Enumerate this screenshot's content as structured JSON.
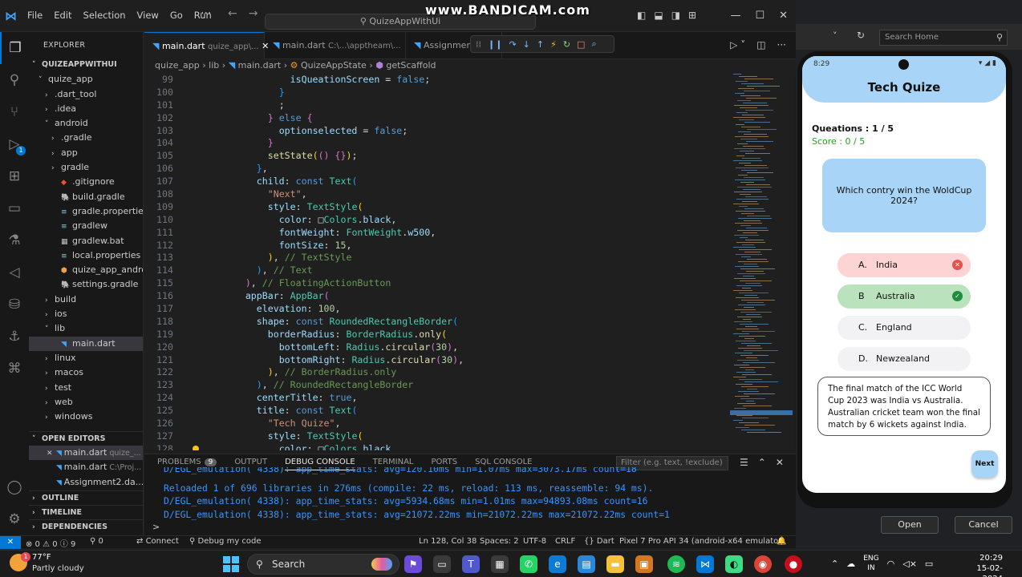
{
  "titlebar": {
    "menu": [
      "File",
      "Edit",
      "Selection",
      "View",
      "Go",
      "Run"
    ],
    "more": "···",
    "search": "QuizeAppWithUi",
    "watermark": "www.BANDICAM.com"
  },
  "sidebar": {
    "header": "EXPLORER",
    "project": "QUIZEAPPWITHUI",
    "tree": [
      {
        "label": "quize_app",
        "depth": 1,
        "chev": "˅",
        "icon": ""
      },
      {
        "label": ".dart_tool",
        "depth": 2,
        "chev": "›",
        "icon": ""
      },
      {
        "label": ".idea",
        "depth": 2,
        "chev": "›",
        "icon": ""
      },
      {
        "label": "android",
        "depth": 2,
        "chev": "˅",
        "icon": ""
      },
      {
        "label": ".gradle",
        "depth": 3,
        "chev": "›",
        "icon": ""
      },
      {
        "label": "app",
        "depth": 3,
        "chev": "›",
        "icon": ""
      },
      {
        "label": "gradle",
        "depth": 3,
        "chev": "›",
        "icon": ""
      },
      {
        "label": ".gitignore",
        "depth": 3,
        "chev": "",
        "icon": "◆"
      },
      {
        "label": "build.gradle",
        "depth": 3,
        "chev": "",
        "icon": "🐘"
      },
      {
        "label": "gradle.properties",
        "depth": 3,
        "chev": "",
        "icon": "≡"
      },
      {
        "label": "gradlew",
        "depth": 3,
        "chev": "",
        "icon": "≡"
      },
      {
        "label": "gradlew.bat",
        "depth": 3,
        "chev": "",
        "icon": "▦"
      },
      {
        "label": "local.properties",
        "depth": 3,
        "chev": "",
        "icon": "≡"
      },
      {
        "label": "quize_app_android...",
        "depth": 3,
        "chev": "",
        "icon": "⬢"
      },
      {
        "label": "settings.gradle",
        "depth": 3,
        "chev": "",
        "icon": "🐘"
      },
      {
        "label": "build",
        "depth": 2,
        "chev": "›",
        "icon": ""
      },
      {
        "label": "ios",
        "depth": 2,
        "chev": "›",
        "icon": ""
      },
      {
        "label": "lib",
        "depth": 2,
        "chev": "˅",
        "icon": ""
      },
      {
        "label": "main.dart",
        "depth": 3,
        "chev": "",
        "icon": "◥",
        "selected": true
      },
      {
        "label": "linux",
        "depth": 2,
        "chev": "›",
        "icon": ""
      },
      {
        "label": "macos",
        "depth": 2,
        "chev": "›",
        "icon": ""
      },
      {
        "label": "test",
        "depth": 2,
        "chev": "›",
        "icon": ""
      },
      {
        "label": "web",
        "depth": 2,
        "chev": "›",
        "icon": ""
      },
      {
        "label": "windows",
        "depth": 2,
        "chev": "›",
        "icon": ""
      }
    ],
    "open_editors_header": "OPEN EDITORS",
    "open_editors": [
      {
        "name": "main.dart",
        "path": "quize_...",
        "close": "✕"
      },
      {
        "name": "main.dart",
        "path": "C:\\Proj...",
        "close": ""
      },
      {
        "name": "Assignment2.da...",
        "path": "",
        "close": ""
      }
    ],
    "outline": "OUTLINE",
    "timeline": "TIMELINE",
    "dependencies": "DEPENDENCIES"
  },
  "tabs": [
    {
      "name": "main.dart",
      "path": "quize_app\\..."
    },
    {
      "name": "main.dart",
      "path": "C:\\...\\apptheam\\..."
    },
    {
      "name": "Assignment2.dart",
      "path": ""
    }
  ],
  "breadcrumb": [
    "quize_app",
    "lib",
    "main.dart",
    "QuizeAppState",
    "getScaffold"
  ],
  "code": [
    {
      "n": "99",
      "indent": 18,
      "parts": [
        [
          "prop",
          "isQueationScreen"
        ],
        [
          "plain",
          " = "
        ],
        [
          "kw",
          "false"
        ],
        [
          "plain",
          ";"
        ]
      ]
    },
    {
      "n": "100",
      "indent": 16,
      "parts": [
        [
          "br3",
          "}"
        ]
      ]
    },
    {
      "n": "101",
      "indent": 16,
      "parts": [
        [
          "plain",
          ";"
        ]
      ]
    },
    {
      "n": "102",
      "indent": 14,
      "parts": [
        [
          "br2",
          "}"
        ],
        [
          "plain",
          " "
        ],
        [
          "kw",
          "else"
        ],
        [
          "plain",
          " "
        ],
        [
          "br2",
          "{"
        ]
      ]
    },
    {
      "n": "103",
      "indent": 16,
      "parts": [
        [
          "prop",
          "optionselected"
        ],
        [
          "plain",
          " = "
        ],
        [
          "kw",
          "false"
        ],
        [
          "plain",
          ";"
        ]
      ]
    },
    {
      "n": "104",
      "indent": 14,
      "parts": [
        [
          "br2",
          "}"
        ]
      ]
    },
    {
      "n": "105",
      "indent": 14,
      "parts": [
        [
          "fn",
          "setState"
        ],
        [
          "br1",
          "("
        ],
        [
          "br2",
          "()"
        ],
        [
          "plain",
          " "
        ],
        [
          "br2",
          "{}"
        ],
        [
          "br1",
          ")"
        ],
        [
          "plain",
          ";"
        ]
      ]
    },
    {
      "n": "106",
      "indent": 12,
      "parts": [
        [
          "br3",
          "}"
        ],
        [
          "plain",
          ","
        ]
      ]
    },
    {
      "n": "107",
      "indent": 12,
      "parts": [
        [
          "prop",
          "child"
        ],
        [
          "plain",
          ": "
        ],
        [
          "kw",
          "const"
        ],
        [
          "plain",
          " "
        ],
        [
          "cls",
          "Text"
        ],
        [
          "br3",
          "("
        ]
      ]
    },
    {
      "n": "108",
      "indent": 14,
      "parts": [
        [
          "str",
          "\"Next\""
        ],
        [
          "plain",
          ","
        ]
      ]
    },
    {
      "n": "109",
      "indent": 14,
      "parts": [
        [
          "prop",
          "style"
        ],
        [
          "plain",
          ": "
        ],
        [
          "cls",
          "TextStyle"
        ],
        [
          "br1",
          "("
        ]
      ]
    },
    {
      "n": "110",
      "indent": 16,
      "parts": [
        [
          "prop",
          "color"
        ],
        [
          "plain",
          ": □"
        ],
        [
          "cls",
          "Colors"
        ],
        [
          "plain",
          "."
        ],
        [
          "prop",
          "black"
        ],
        [
          "plain",
          ","
        ]
      ]
    },
    {
      "n": "111",
      "indent": 16,
      "parts": [
        [
          "prop",
          "fontWeight"
        ],
        [
          "plain",
          ": "
        ],
        [
          "cls",
          "FontWeight"
        ],
        [
          "plain",
          "."
        ],
        [
          "prop",
          "w500"
        ],
        [
          "plain",
          ","
        ]
      ]
    },
    {
      "n": "112",
      "indent": 16,
      "parts": [
        [
          "prop",
          "fontSize"
        ],
        [
          "plain",
          ": "
        ],
        [
          "num",
          "15"
        ],
        [
          "plain",
          ","
        ]
      ]
    },
    {
      "n": "113",
      "indent": 14,
      "parts": [
        [
          "br1",
          ")"
        ],
        [
          "plain",
          ", "
        ],
        [
          "cmt",
          "// TextStyle"
        ]
      ]
    },
    {
      "n": "114",
      "indent": 12,
      "parts": [
        [
          "br3",
          ")"
        ],
        [
          "plain",
          ", "
        ],
        [
          "cmt",
          "// Text"
        ]
      ]
    },
    {
      "n": "115",
      "indent": 10,
      "parts": [
        [
          "br2",
          ")"
        ],
        [
          "plain",
          ", "
        ],
        [
          "cmt",
          "// FloatingActionButton"
        ]
      ]
    },
    {
      "n": "116",
      "indent": 10,
      "parts": [
        [
          "prop",
          "appBar"
        ],
        [
          "plain",
          ": "
        ],
        [
          "cls",
          "AppBar"
        ],
        [
          "br2",
          "("
        ]
      ]
    },
    {
      "n": "117",
      "indent": 12,
      "parts": [
        [
          "prop",
          "elevation"
        ],
        [
          "plain",
          ": "
        ],
        [
          "num",
          "100"
        ],
        [
          "plain",
          ","
        ]
      ]
    },
    {
      "n": "118",
      "indent": 12,
      "parts": [
        [
          "prop",
          "shape"
        ],
        [
          "plain",
          ": "
        ],
        [
          "kw",
          "const"
        ],
        [
          "plain",
          " "
        ],
        [
          "cls",
          "RoundedRectangleBorder"
        ],
        [
          "br3",
          "("
        ]
      ]
    },
    {
      "n": "119",
      "indent": 14,
      "parts": [
        [
          "prop",
          "borderRadius"
        ],
        [
          "plain",
          ": "
        ],
        [
          "cls",
          "BorderRadius"
        ],
        [
          "plain",
          "."
        ],
        [
          "fn",
          "only"
        ],
        [
          "br1",
          "("
        ]
      ]
    },
    {
      "n": "120",
      "indent": 16,
      "parts": [
        [
          "prop",
          "bottomLeft"
        ],
        [
          "plain",
          ": "
        ],
        [
          "cls",
          "Radius"
        ],
        [
          "plain",
          "."
        ],
        [
          "fn",
          "circular"
        ],
        [
          "br2",
          "("
        ],
        [
          "num",
          "30"
        ],
        [
          "br2",
          ")"
        ],
        [
          "plain",
          ","
        ]
      ]
    },
    {
      "n": "121",
      "indent": 16,
      "parts": [
        [
          "prop",
          "bottomRight"
        ],
        [
          "plain",
          ": "
        ],
        [
          "cls",
          "Radius"
        ],
        [
          "plain",
          "."
        ],
        [
          "fn",
          "circular"
        ],
        [
          "br2",
          "("
        ],
        [
          "num",
          "30"
        ],
        [
          "br2",
          ")"
        ],
        [
          "plain",
          ","
        ]
      ]
    },
    {
      "n": "122",
      "indent": 14,
      "parts": [
        [
          "br1",
          ")"
        ],
        [
          "plain",
          ", "
        ],
        [
          "cmt",
          "// BorderRadius.only"
        ]
      ]
    },
    {
      "n": "123",
      "indent": 12,
      "parts": [
        [
          "br3",
          ")"
        ],
        [
          "plain",
          ", "
        ],
        [
          "cmt",
          "// RoundedRectangleBorder"
        ]
      ]
    },
    {
      "n": "124",
      "indent": 12,
      "parts": [
        [
          "prop",
          "centerTitle"
        ],
        [
          "plain",
          ": "
        ],
        [
          "kw",
          "true"
        ],
        [
          "plain",
          ","
        ]
      ]
    },
    {
      "n": "125",
      "indent": 12,
      "parts": [
        [
          "prop",
          "title"
        ],
        [
          "plain",
          ": "
        ],
        [
          "kw",
          "const"
        ],
        [
          "plain",
          " "
        ],
        [
          "cls",
          "Text"
        ],
        [
          "br3",
          "("
        ]
      ]
    },
    {
      "n": "126",
      "indent": 14,
      "parts": [
        [
          "str",
          "\"Tech Quize\""
        ],
        [
          "plain",
          ","
        ]
      ]
    },
    {
      "n": "127",
      "indent": 14,
      "parts": [
        [
          "prop",
          "style"
        ],
        [
          "plain",
          ": "
        ],
        [
          "cls",
          "TextStyle"
        ],
        [
          "br1",
          "("
        ]
      ]
    },
    {
      "n": "128",
      "indent": 16,
      "parts": [
        [
          "prop",
          "color"
        ],
        [
          "plain",
          ": □"
        ],
        [
          "cls",
          "Colors"
        ],
        [
          "plain",
          "."
        ],
        [
          "prop",
          "black"
        ]
      ]
    }
  ],
  "panel": {
    "tabs": [
      "PROBLEMS",
      "OUTPUT",
      "DEBUG CONSOLE",
      "TERMINAL",
      "PORTS",
      "SQL CONSOLE"
    ],
    "problems_count": "9",
    "filter_placeholder": "Filter (e.g. text, !exclude)",
    "console": [
      "D/EGL_emulation( 4338): app_time_stats: avg=120.10ms min=1.07ms max=3073.17ms count=18",
      "Reloaded 1 of 696 libraries in 276ms (compile: 22 ms, reload: 113 ms, reassemble: 94 ms).",
      "D/EGL_emulation( 4338): app_time_stats: avg=5934.68ms min=1.01ms max=94893.08ms count=16",
      "D/EGL_emulation( 4338): app_time_stats: avg=21072.22ms min=21072.22ms max=21072.22ms count=1"
    ],
    "prompt": ">"
  },
  "status": {
    "errors": "⊗ 0 ⚠ 0 ⓘ 9",
    "ports": "⚲ 0",
    "connect": "Connect",
    "debug": "Debug my code",
    "position": "Ln 128, Col 38",
    "spaces": "Spaces: 2",
    "encoding": "UTF-8",
    "eol": "CRLF",
    "language": "{} Dart",
    "device": "Pixel 7 Pro API 34 (android-x64 emulator)"
  },
  "browser": {
    "search_placeholder": "Search Home",
    "open_label": "Open",
    "cancel_label": "Cancel"
  },
  "phone": {
    "time": "8:29",
    "title": "Tech Quize",
    "question_count": "Queations : 1 / 5",
    "score": "Score : 0 / 5",
    "question": "Which contry win the WoldCup 2024?",
    "options": [
      {
        "letter": "A.",
        "text": "India",
        "state": "wrong",
        "bg": "#fdd3d3",
        "mark_color": "#e5534b"
      },
      {
        "letter": "B",
        "text": "Australia",
        "state": "correct",
        "bg": "#b9e2bd",
        "mark_color": "#1e8e3e"
      },
      {
        "letter": "C.",
        "text": "England",
        "state": "none",
        "bg": "#f2f1f4",
        "mark_color": ""
      },
      {
        "letter": "D.",
        "text": "Newzealand",
        "state": "none",
        "bg": "#f2f1f4",
        "mark_color": ""
      }
    ],
    "explanation": "The final match of the ICC World Cup 2023 was India vs Australia. Australian cricket team won the final match by 6 wickets against India.",
    "next_label": "Next"
  },
  "taskbar": {
    "temp": "77°F",
    "weather": "Partly cloudy",
    "weather_badge": "1",
    "search": "Search",
    "lang1": "ENG",
    "lang2": "IN",
    "time": "20:29",
    "date": "15-02-2024"
  }
}
